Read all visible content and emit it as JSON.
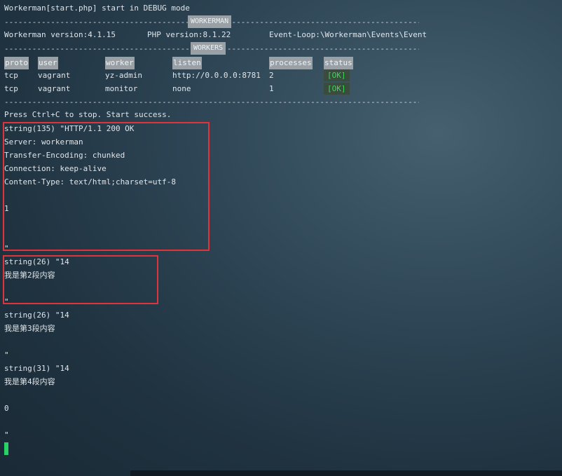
{
  "title_line": "Workerman[start.php] start in DEBUG mode",
  "dashes": "----------------------------------------------------------------------------------------------------------------",
  "sep_workerman": "WORKERMAN",
  "sep_workers": "WORKERS",
  "info": {
    "version": "Workerman version:4.1.15",
    "php": "PHP version:8.1.22",
    "loop": "Event-Loop:\\Workerman\\Events\\Event"
  },
  "table": {
    "headers": [
      "proto",
      "user",
      "worker",
      "listen",
      "processes",
      "status"
    ],
    "rows": [
      [
        "tcp",
        "vagrant",
        "yz-admin",
        "http://0.0.0.0:8781",
        "2",
        "[OK]"
      ],
      [
        "tcp",
        "vagrant",
        "monitor",
        "none",
        "1",
        "[OK]"
      ]
    ]
  },
  "start_msg": "Press Ctrl+C to stop. Start success.",
  "output": [
    "string(135) \"HTTP/1.1 200 OK",
    "Server: workerman",
    "Transfer-Encoding: chunked",
    "Connection: keep-alive",
    "Content-Type: text/html;charset=utf-8",
    "",
    "1",
    "",
    "",
    "\"",
    "string(26) \"14",
    "我是第2段内容",
    "",
    "\"",
    "string(26) \"14",
    "我是第3段内容",
    "",
    "\"",
    "string(31) \"14",
    "我是第4段内容",
    "",
    "0",
    "",
    "\""
  ],
  "colors": {
    "highlight_box": "#e0333a",
    "ok_green": "#3fd65a",
    "cursor": "#25d366",
    "header_bg": "#9aa1a6"
  }
}
